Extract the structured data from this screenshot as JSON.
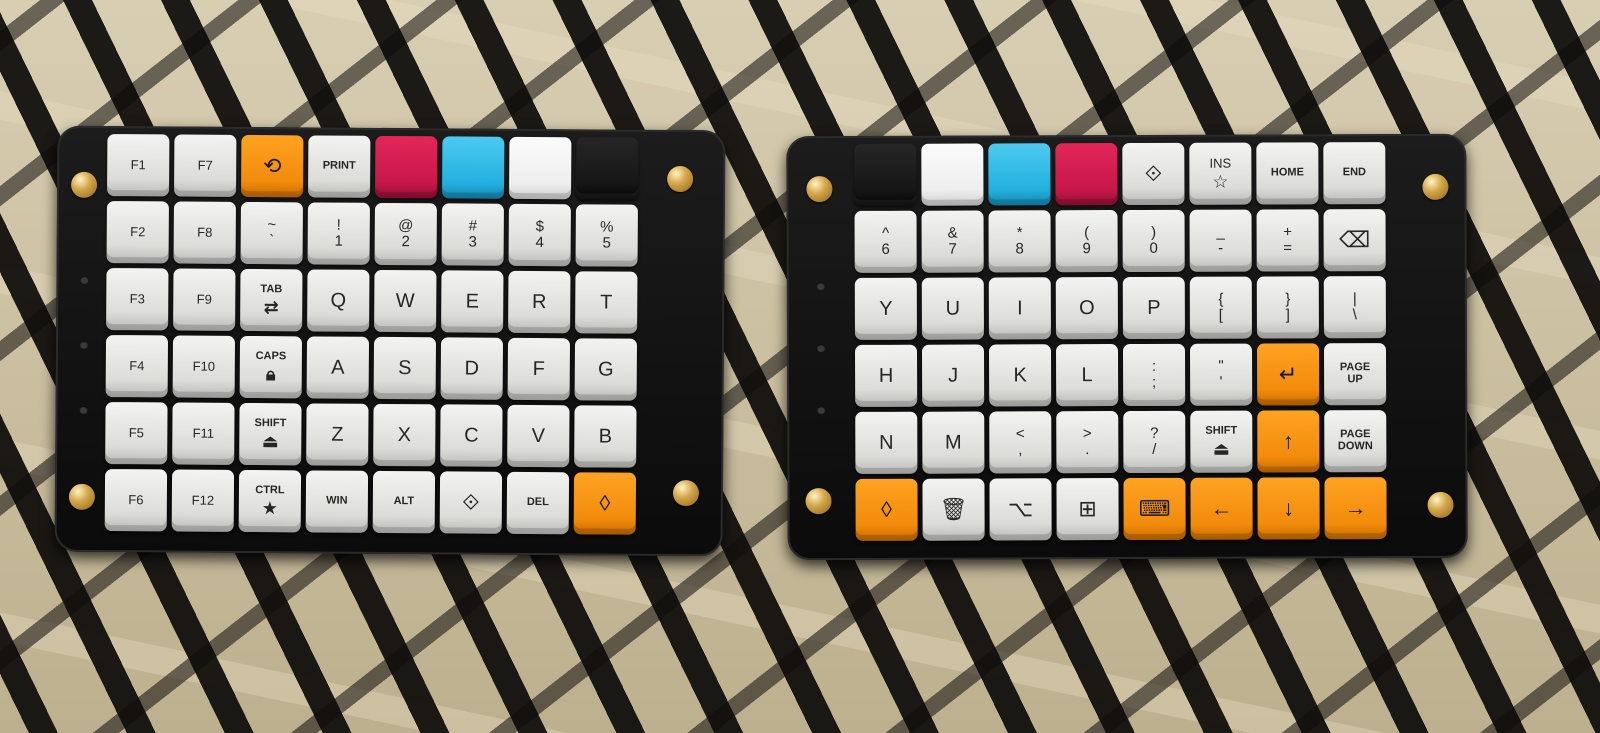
{
  "left_half": {
    "keys": [
      {
        "l": "F1",
        "c": "gray"
      },
      {
        "l": "F7",
        "c": "gray"
      },
      {
        "l": "",
        "c": "orange",
        "i": "⟲"
      },
      {
        "l": "PRINT",
        "c": "gray",
        "m": 1
      },
      {
        "l": "",
        "c": "red"
      },
      {
        "l": "",
        "c": "blue"
      },
      {
        "l": "",
        "c": "white"
      },
      {
        "l": "",
        "c": "black"
      },
      {
        "l": "F2",
        "c": "gray"
      },
      {
        "l": "F8",
        "c": "gray"
      },
      {
        "l": "~\n`",
        "c": "gray",
        "s": 1
      },
      {
        "l": "!\n1",
        "c": "gray",
        "s": 1
      },
      {
        "l": "@\n2",
        "c": "gray",
        "s": 1
      },
      {
        "l": "#\n3",
        "c": "gray",
        "s": 1
      },
      {
        "l": "$\n4",
        "c": "gray",
        "s": 1
      },
      {
        "l": "%\n5",
        "c": "gray",
        "s": 1
      },
      {
        "l": "F3",
        "c": "gray"
      },
      {
        "l": "F9",
        "c": "gray"
      },
      {
        "l": "TAB",
        "c": "gray",
        "m": 1,
        "i": "⇄"
      },
      {
        "l": "Q",
        "c": "gray",
        "b": 1
      },
      {
        "l": "W",
        "c": "gray",
        "b": 1
      },
      {
        "l": "E",
        "c": "gray",
        "b": 1
      },
      {
        "l": "R",
        "c": "gray",
        "b": 1
      },
      {
        "l": "T",
        "c": "gray",
        "b": 1
      },
      {
        "l": "F4",
        "c": "gray"
      },
      {
        "l": "F10",
        "c": "gray"
      },
      {
        "l": "CAPS",
        "c": "gray",
        "m": 1,
        "i": "🔒︎"
      },
      {
        "l": "A",
        "c": "gray",
        "b": 1
      },
      {
        "l": "S",
        "c": "gray",
        "b": 1
      },
      {
        "l": "D",
        "c": "gray",
        "b": 1
      },
      {
        "l": "F",
        "c": "gray",
        "b": 1
      },
      {
        "l": "G",
        "c": "gray",
        "b": 1
      },
      {
        "l": "F5",
        "c": "gray"
      },
      {
        "l": "F11",
        "c": "gray"
      },
      {
        "l": "SHIFT",
        "c": "gray",
        "m": 1,
        "i": "⏏"
      },
      {
        "l": "Z",
        "c": "gray",
        "b": 1
      },
      {
        "l": "X",
        "c": "gray",
        "b": 1
      },
      {
        "l": "C",
        "c": "gray",
        "b": 1
      },
      {
        "l": "V",
        "c": "gray",
        "b": 1
      },
      {
        "l": "B",
        "c": "gray",
        "b": 1
      },
      {
        "l": "F6",
        "c": "gray"
      },
      {
        "l": "F12",
        "c": "gray"
      },
      {
        "l": "CTRL",
        "c": "gray",
        "m": 1,
        "i": "★"
      },
      {
        "l": "WIN",
        "c": "gray",
        "m": 1
      },
      {
        "l": "ALT",
        "c": "gray",
        "m": 1
      },
      {
        "l": "",
        "c": "gray",
        "i": "⟐"
      },
      {
        "l": "DEL",
        "c": "gray",
        "m": 1
      },
      {
        "l": "",
        "c": "orange",
        "i": "◊"
      }
    ]
  },
  "right_half": {
    "keys": [
      {
        "l": "",
        "c": "black"
      },
      {
        "l": "",
        "c": "white"
      },
      {
        "l": "",
        "c": "blue"
      },
      {
        "l": "",
        "c": "red"
      },
      {
        "l": "",
        "c": "gray",
        "i": "⟐"
      },
      {
        "l": "INS",
        "c": "gray",
        "i": "☆"
      },
      {
        "l": "HOME",
        "c": "gray",
        "m": 1
      },
      {
        "l": "END",
        "c": "gray",
        "m": 1
      },
      {
        "l": "^\n6",
        "c": "gray",
        "s": 1
      },
      {
        "l": "&\n7",
        "c": "gray",
        "s": 1
      },
      {
        "l": "*\n8",
        "c": "gray",
        "s": 1
      },
      {
        "l": "(\n9",
        "c": "gray",
        "s": 1
      },
      {
        "l": ")\n0",
        "c": "gray",
        "s": 1
      },
      {
        "l": "_\n-",
        "c": "gray",
        "s": 1
      },
      {
        "l": "+\n=",
        "c": "gray",
        "s": 1
      },
      {
        "l": "",
        "c": "gray",
        "i": "⌫"
      },
      {
        "l": "Y",
        "c": "gray",
        "b": 1
      },
      {
        "l": "U",
        "c": "gray",
        "b": 1
      },
      {
        "l": "I",
        "c": "gray",
        "b": 1
      },
      {
        "l": "O",
        "c": "gray",
        "b": 1
      },
      {
        "l": "P",
        "c": "gray",
        "b": 1
      },
      {
        "l": "{\n[",
        "c": "gray",
        "s": 1
      },
      {
        "l": "}\n]",
        "c": "gray",
        "s": 1
      },
      {
        "l": "|\n\\",
        "c": "gray",
        "s": 1
      },
      {
        "l": "H",
        "c": "gray",
        "b": 1
      },
      {
        "l": "J",
        "c": "gray",
        "b": 1
      },
      {
        "l": "K",
        "c": "gray",
        "b": 1
      },
      {
        "l": "L",
        "c": "gray",
        "b": 1
      },
      {
        "l": ":\n;",
        "c": "gray",
        "s": 1
      },
      {
        "l": "\"\n'",
        "c": "gray",
        "s": 1
      },
      {
        "l": "",
        "c": "orange",
        "i": "↵"
      },
      {
        "l": "PAGE\nUP",
        "c": "gray",
        "m": 1
      },
      {
        "l": "N",
        "c": "gray",
        "b": 1
      },
      {
        "l": "M",
        "c": "gray",
        "b": 1
      },
      {
        "l": "<\n,",
        "c": "gray",
        "s": 1
      },
      {
        "l": ">\n.",
        "c": "gray",
        "s": 1
      },
      {
        "l": "?\n/",
        "c": "gray",
        "s": 1
      },
      {
        "l": "SHIFT",
        "c": "gray",
        "m": 1,
        "i": "⏏"
      },
      {
        "l": "",
        "c": "orange",
        "i": "↑"
      },
      {
        "l": "PAGE\nDOWN",
        "c": "gray",
        "m": 1
      },
      {
        "l": "",
        "c": "orange",
        "i": "◊"
      },
      {
        "l": "",
        "c": "gray",
        "i": "🗑︎"
      },
      {
        "l": "",
        "c": "gray",
        "i": "⌥"
      },
      {
        "l": "",
        "c": "gray",
        "i": "⊞"
      },
      {
        "l": "",
        "c": "orange",
        "i": "⌨"
      },
      {
        "l": "",
        "c": "orange",
        "i": "←"
      },
      {
        "l": "",
        "c": "orange",
        "i": "↓"
      },
      {
        "l": "",
        "c": "orange",
        "i": "→"
      }
    ]
  },
  "colors": {
    "orange": "#f28b0c",
    "red": "#c8174a",
    "blue": "#23b0df",
    "case": "#111111",
    "brass": "#d5a74a"
  }
}
